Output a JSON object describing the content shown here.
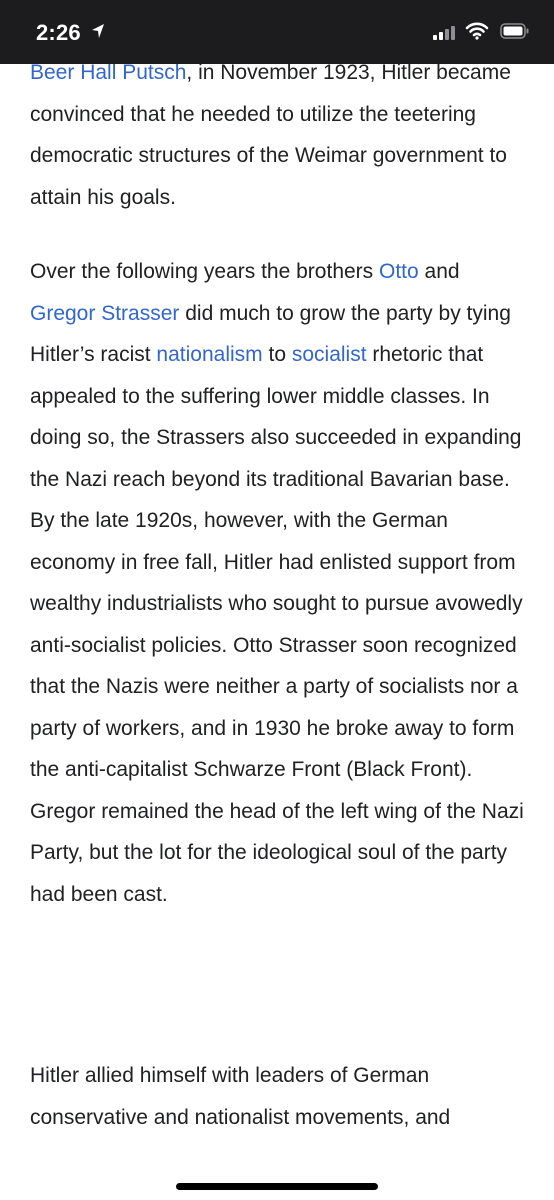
{
  "status_bar": {
    "time": "2:26",
    "icons": [
      "location-arrow-icon",
      "cellular-signal-icon",
      "wifi-icon",
      "battery-icon"
    ]
  },
  "article": {
    "p1": {
      "link": "Beer Hall Putsch",
      "text": ", in November 1923, Hitler became convinced that he needed to utilize the teetering democratic structures of the Weimar government to attain his goals."
    },
    "p2": {
      "t0": "Over the following years the brothers ",
      "link_otto": "Otto",
      "t1": " and ",
      "link_gregor": "Gregor Strasser",
      "t2": " did much to grow the party by tying Hitler’s racist ",
      "link_nationalism": "nationalism",
      "t3": " to ",
      "link_socialist": "socialist",
      "t4": " rhetoric that appealed to the suffering lower middle classes. In doing so, the Strassers also succeeded in expanding the Nazi reach beyond its traditional Bavarian base. By the late 1920s, however, with the German economy in free fall, Hitler had enlisted support from wealthy industrialists who sought to pursue avowedly anti-socialist policies. Otto Strasser soon recognized that the Nazis were neither a party of socialists nor a party of workers, and in 1930 he broke away to form the anti-capitalist Schwarze Front (Black Front). Gregor remained the head of the left wing of the Nazi Party, but the lot for the ideological soul of the party had been cast."
    },
    "p3": {
      "text": "Hitler allied himself with leaders of German conservative and nationalist movements, and"
    }
  },
  "colors": {
    "link": "#3366cc",
    "text": "#202122",
    "status_bar_bg": "#1c1c1e"
  }
}
